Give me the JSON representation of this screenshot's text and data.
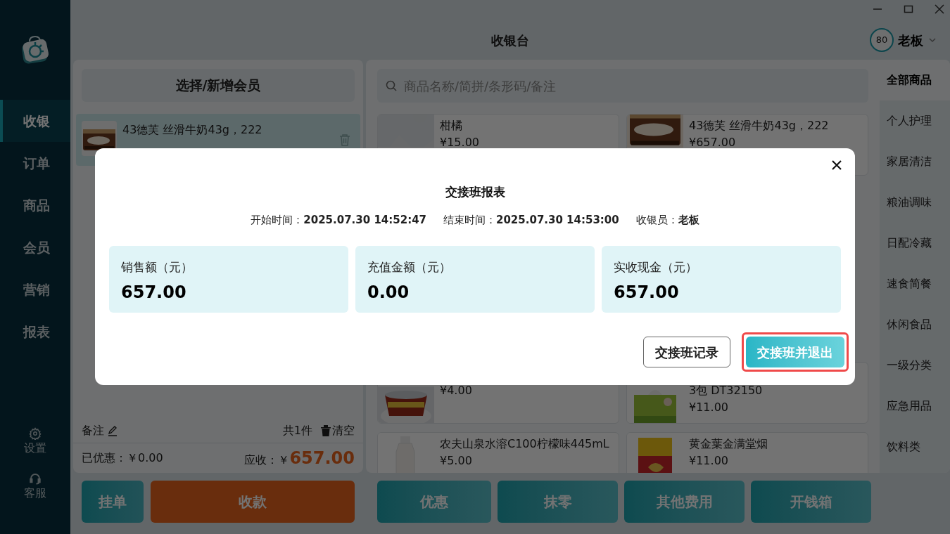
{
  "window": {
    "title": "收银台"
  },
  "user": {
    "avatar": "80",
    "name": "老板"
  },
  "nav": [
    {
      "label": "收银",
      "selected": true
    },
    {
      "label": "订单",
      "selected": false
    },
    {
      "label": "商品",
      "selected": false
    },
    {
      "label": "会员",
      "selected": false
    },
    {
      "label": "营销",
      "selected": false
    },
    {
      "label": "报表",
      "selected": false
    }
  ],
  "nav_bottom": [
    {
      "kind": "settings",
      "label": "设置"
    },
    {
      "kind": "service",
      "label": "客服"
    }
  ],
  "member_button": "选择/新增会员",
  "cart": [
    {
      "name": "43德芙 丝滑牛奶43g，222"
    }
  ],
  "remark": "备注",
  "count": "共1件",
  "clear": "清空",
  "discounted": "已优惠：￥0.00",
  "due_label": "应收：￥",
  "due": "657.00",
  "left_buttons": [
    {
      "kind": "teal",
      "label": "挂单"
    },
    {
      "kind": "orange",
      "label": "收款"
    }
  ],
  "search": {
    "placeholder": "商品名称/简拼/条形码/备注"
  },
  "products": [
    {
      "name": "柑橘",
      "price": "¥15.00",
      "kind": "blank"
    },
    {
      "name": "43德芙 丝滑牛奶43g，222",
      "price": "¥657.00",
      "kind": "chocolate"
    },
    {
      "price": "¥4.00",
      "kind": "bowl"
    },
    {
      "name": "3包 DT32150",
      "price": "¥11.00",
      "kind": "tissue"
    },
    {
      "name": "农夫山泉水溶C100柠檬味445mL",
      "price": "¥5.00",
      "kind": "bottle"
    },
    {
      "name": "黄金葉金满堂烟",
      "price": "¥11.00",
      "kind": "cigarette"
    }
  ],
  "categories": [
    {
      "label": "全部商品",
      "selected": true
    },
    {
      "label": "个人护理",
      "selected": false
    },
    {
      "label": "家居清洁",
      "selected": false
    },
    {
      "label": "粮油调味",
      "selected": false
    },
    {
      "label": "日配冷藏",
      "selected": false
    },
    {
      "label": "速食简餐",
      "selected": false
    },
    {
      "label": "休闲食品",
      "selected": false
    },
    {
      "label": "一级分类",
      "selected": false
    },
    {
      "label": "应急用品",
      "selected": false
    },
    {
      "label": "饮料类",
      "selected": false
    }
  ],
  "right_buttons": [
    "优惠",
    "抹零",
    "其他费用",
    "开钱箱"
  ],
  "dialog": {
    "title": "交接班报表",
    "info": [
      {
        "label": "开始时间：",
        "value": "2025.07.30 14:52:47"
      },
      {
        "label": "结束时间：",
        "value": "2025.07.30 14:53:00"
      },
      {
        "label": "收银员：",
        "value": "老板"
      }
    ],
    "stats": [
      {
        "label": "销售额（元）",
        "value": "657.00"
      },
      {
        "label": "充值金额（元）",
        "value": "0.00"
      },
      {
        "label": "实收现金（元）",
        "value": "657.00"
      }
    ],
    "buttons": [
      {
        "kind": "outline",
        "label": "交接班记录",
        "highlighted": false
      },
      {
        "kind": "primary",
        "label": "交接班并退出",
        "highlighted": true
      }
    ]
  }
}
